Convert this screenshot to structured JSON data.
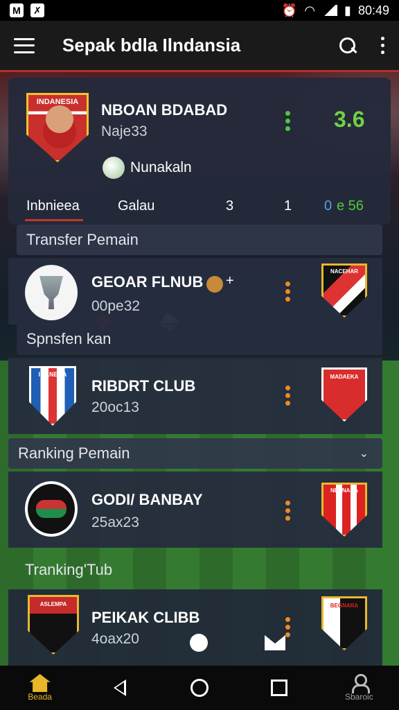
{
  "status": {
    "time": "80:49"
  },
  "appbar": {
    "title": "Sepak bdla Ilndansia"
  },
  "hero": {
    "crest_text": "INDANESIA",
    "team": "NBOAN BDABAD",
    "sub": "Naje33",
    "score": "3.6",
    "venue": "Nunakaln",
    "stats": {
      "tab": "Inbnieea",
      "label": "Galau",
      "v1": "3",
      "v2": "1",
      "v3": "0",
      "v4": "e 56"
    }
  },
  "sections": {
    "transfer": "Transfer Pemain",
    "sponsor": "Spnsfen kan",
    "ranking": "Ranking Pemain",
    "tranking": "Tranking'Tub"
  },
  "rows": [
    {
      "name": "GEOAR FLNUB",
      "sub": "00pe32",
      "rbadge": "NACEHAR"
    },
    {
      "name": "RIBDRT CLUB",
      "sub": "20oc13",
      "lbadge": "IDANERA",
      "rbadge": "MADAEKA"
    },
    {
      "name": "GODI/ BANBAY",
      "sub": "25ax23",
      "rbadge": "NEANARA"
    },
    {
      "name": "PEIKAK CLIBB",
      "sub": "4oax20",
      "lbadge": "ASLEMPA",
      "rbadge": "BEGNARA"
    }
  ],
  "tabbar": {
    "home": "Beada",
    "profile": "Sbaroic"
  },
  "colors": {
    "accent": "#b1322e",
    "score": "#6ed243",
    "home_tab": "#e9b62a",
    "dots": "#f08a24"
  }
}
